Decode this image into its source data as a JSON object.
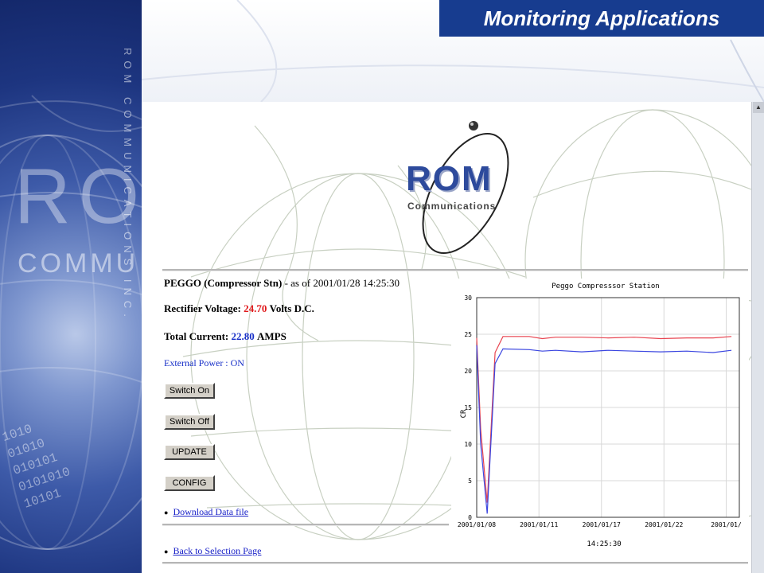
{
  "slide": {
    "title": "Monitoring Applications",
    "side_brand_letters": "RO",
    "side_brand_word": "COMMU",
    "side_vertical_text": "ROM COMMUNICATIONS INC.",
    "side_binary": [
      "1010",
      "01010",
      "010101",
      "0101010",
      "10101"
    ]
  },
  "logo": {
    "name": "ROM",
    "tagline": "Communications"
  },
  "station": {
    "name": "PEGGO (Compressor Stn)",
    "asof_prefix": "- as of",
    "timestamp": "2001/01/28 14:25:30",
    "voltage_label": "Rectifier Voltage:",
    "voltage_value": "24.70",
    "voltage_unit": "Volts D.C.",
    "current_label": "Total Current:",
    "current_value": "22.80",
    "current_unit": "AMPS",
    "external_power": "External Power : ON"
  },
  "buttons": {
    "switch_on": "Switch On",
    "switch_off": "Switch Off",
    "update": "UPDATE",
    "config": "CONFIG"
  },
  "links": {
    "download": "Download Data file",
    "back": "Back to Selection Page"
  },
  "colors": {
    "title_bg": "#173c8f",
    "voltage": "#e0191b",
    "current": "#1830c8",
    "series_red": "#e8434f",
    "series_blue": "#3b46e0"
  },
  "chart_data": {
    "type": "line",
    "title": "Peggo Compresssor Station",
    "ylabel": "CR",
    "xlabel_time": "14:25:30",
    "ylim": [
      0,
      30
    ],
    "yticks": [
      "0",
      "5",
      "10",
      "15",
      "20",
      "25",
      "30"
    ],
    "xlim": [
      0,
      1
    ],
    "xticks": [
      {
        "pos": 0,
        "label": "2001/01/08"
      },
      {
        "pos": 0.237,
        "label": "2001/01/11"
      },
      {
        "pos": 0.475,
        "label": "2001/01/17"
      },
      {
        "pos": 0.713,
        "label": "2001/01/22"
      },
      {
        "pos": 0.95,
        "label": "2001/01/"
      }
    ],
    "grid": true,
    "series": [
      {
        "color": "#e8434f",
        "x": [
          0,
          0.015,
          0.04,
          0.07,
          0.1,
          0.2,
          0.25,
          0.3,
          0.4,
          0.5,
          0.6,
          0.7,
          0.8,
          0.9,
          0.97
        ],
        "y": [
          24.5,
          12,
          2,
          22.5,
          24.7,
          24.7,
          24.4,
          24.6,
          24.6,
          24.5,
          24.6,
          24.4,
          24.5,
          24.5,
          24.7
        ]
      },
      {
        "color": "#3b46e0",
        "x": [
          0,
          0.015,
          0.04,
          0.07,
          0.1,
          0.2,
          0.25,
          0.3,
          0.4,
          0.5,
          0.6,
          0.7,
          0.8,
          0.9,
          0.97
        ],
        "y": [
          23.5,
          10,
          0.5,
          21,
          23,
          22.9,
          22.7,
          22.8,
          22.6,
          22.8,
          22.7,
          22.6,
          22.7,
          22.5,
          22.8
        ]
      }
    ]
  }
}
